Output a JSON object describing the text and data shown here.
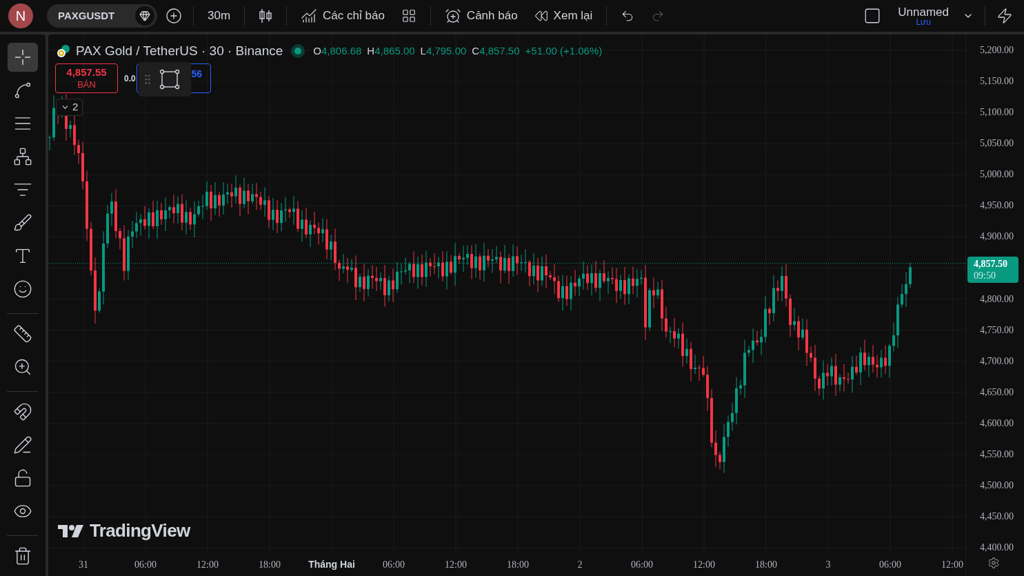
{
  "top_bar": {
    "avatar": "N",
    "symbol": "PAXGUSDT",
    "interval": "30m",
    "indicators": "Các chỉ báo",
    "alerts": "Cảnh báo",
    "replay": "Xem lại",
    "layout_name": "Unnamed",
    "save": "Lưu"
  },
  "tool_groups": [
    [
      {
        "selected": true
      },
      {
        "selected": false
      },
      {
        "selected": false
      },
      {
        "selected": false
      },
      {
        "selected": false
      },
      {
        "selected": false
      },
      {
        "selected": false
      },
      {
        "selected": false
      }
    ],
    [
      {
        "selected": false
      },
      {
        "selected": false
      }
    ],
    [
      {
        "selected": false
      },
      {
        "selected": false
      },
      {
        "selected": false
      },
      {
        "selected": false
      }
    ],
    [
      {
        "selected": false
      }
    ]
  ],
  "legend": {
    "title": "PAX Gold / TetherUS · 30 · Binance",
    "ohlc": [
      {
        "label": "O",
        "value": "4,806.68"
      },
      {
        "label": "H",
        "value": "4,865.00"
      },
      {
        "label": "L",
        "value": "4,795.00"
      },
      {
        "label": "C",
        "value": "4,857.50"
      }
    ],
    "change": "+51.00 (+1.06%)"
  },
  "trade": {
    "sell_price": "4,857.55",
    "sell_label": "BÁN",
    "spread": "0.0",
    "buy_price": "56"
  },
  "indicators_toggle": "2",
  "watermark_logo": "TradingView",
  "price_axis": {
    "above_current": [
      "5,200.00",
      "5,150.00",
      "5,100.00",
      "5,050.00",
      "5,000.00",
      "4,950.00",
      "4,900.00"
    ],
    "below_current": [
      "4,800.00",
      "4,750.00",
      "4,700.00",
      "4,650.00",
      "4,600.00",
      "4,550.00",
      "4,500.00",
      "4,450.00",
      "4,400.00"
    ]
  },
  "current_price": {
    "price": "4,857.50",
    "countdown": "09:50"
  },
  "time_axis": [
    {
      "text": "31",
      "kind": "day"
    },
    {
      "text": "06:00",
      "kind": "time"
    },
    {
      "text": "12:00",
      "kind": "time"
    },
    {
      "text": "18:00",
      "kind": "time"
    },
    {
      "text": "Tháng Hai",
      "kind": "month"
    },
    {
      "text": "06:00",
      "kind": "time"
    },
    {
      "text": "12:00",
      "kind": "time"
    },
    {
      "text": "18:00",
      "kind": "time"
    },
    {
      "text": "2",
      "kind": "day"
    },
    {
      "text": "06:00",
      "kind": "time"
    },
    {
      "text": "12:00",
      "kind": "time"
    },
    {
      "text": "18:00",
      "kind": "time"
    },
    {
      "text": "3",
      "kind": "day"
    },
    {
      "text": "06:00",
      "kind": "time"
    },
    {
      "text": "12:00",
      "kind": "time"
    }
  ]
}
